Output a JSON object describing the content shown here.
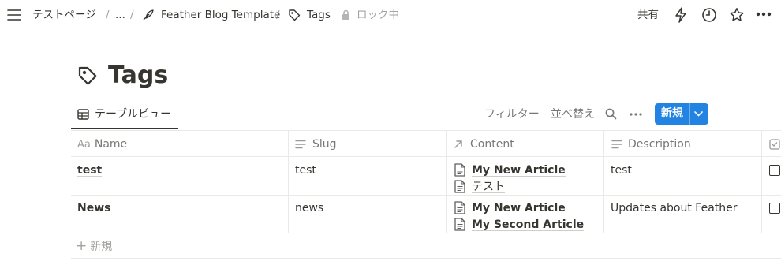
{
  "breadcrumb": {
    "items": [
      "テストページ",
      "...",
      "Feather Blog Template",
      "Tags"
    ],
    "separator": "/",
    "lock_label": "ロック中"
  },
  "topbar": {
    "share_label": "共有"
  },
  "page": {
    "title": "Tags"
  },
  "view": {
    "tab_label": "テーブルビュー"
  },
  "toolbar": {
    "filter_label": "フィルター",
    "sort_label": "並べ替え",
    "new_label": "新規"
  },
  "table": {
    "columns": [
      {
        "label": "Name",
        "icon": "Aa"
      },
      {
        "label": "Slug",
        "icon": "lines-icon"
      },
      {
        "label": "Content",
        "icon": "arrow-up-right-icon"
      },
      {
        "label": "Description",
        "icon": "lines-icon"
      },
      {
        "label": "",
        "icon": "checkbox-icon"
      }
    ],
    "rows": [
      {
        "name": "test",
        "slug": "test",
        "content": [
          "My New Article",
          "テスト"
        ],
        "description": "test",
        "checked": false
      },
      {
        "name": "News",
        "slug": "news",
        "content": [
          "My New Article",
          "My Second Article"
        ],
        "description": "Updates about Feather",
        "checked": false
      }
    ],
    "add_row_label": "新規"
  },
  "colors": {
    "text": "#37352f",
    "muted": "#787774",
    "accent": "#2383e2",
    "border": "#e9e9e7"
  }
}
